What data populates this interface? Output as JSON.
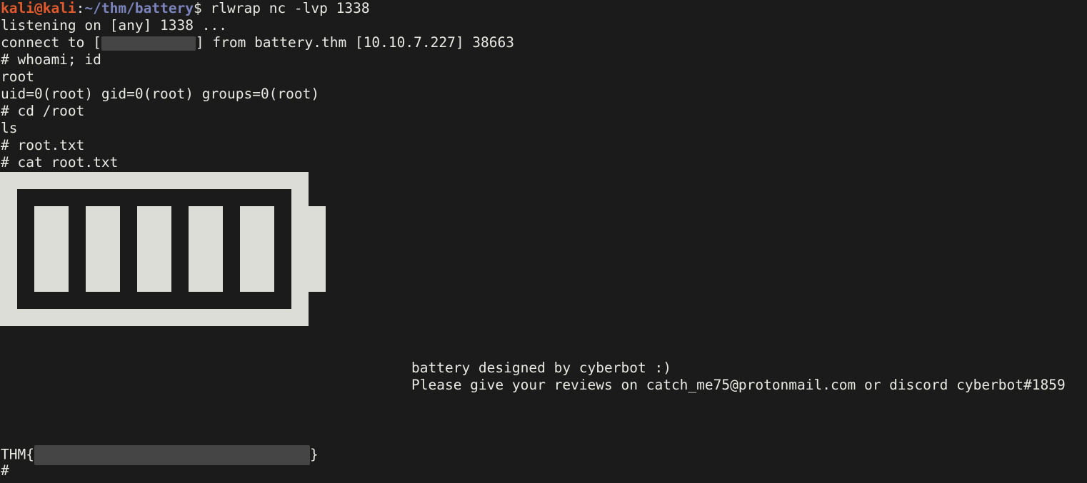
{
  "prompt": {
    "user_host": "kali@kali",
    "sep": ":",
    "path": "~/thm/battery",
    "dollar": "$",
    "command": " rlwrap nc -lvp 1338"
  },
  "lines": {
    "listening": "listening on [any] 1338 ...",
    "connect_pre": "connect to [",
    "connect_post": "] from battery.thm [10.10.7.227] 38663",
    "whoami_cmd": "# whoami; id",
    "whoami_out": "root",
    "id_out": "uid=0(root) gid=0(root) groups=0(root)",
    "cd_cmd": "# cd /root",
    "ls_cmd": "ls",
    "ls_out": "# root.txt",
    "cat_cmd": "# cat root.txt"
  },
  "credits": {
    "line1": "battery designed by cyberbot :)",
    "line2": "Please give your reviews on catch_me75@protonmail.com or discord cyberbot#1859"
  },
  "flag": {
    "prefix": "THM{",
    "suffix": "}"
  },
  "final_prompt": "#",
  "colors": {
    "background": "#1b1b1b",
    "foreground": "#e7e9e2",
    "prompt_user": "#e15a2d",
    "prompt_path": "#7b84bd",
    "battery": "#dcddd7",
    "redaction": "#454545"
  },
  "battery_art": {
    "cells": 5
  }
}
